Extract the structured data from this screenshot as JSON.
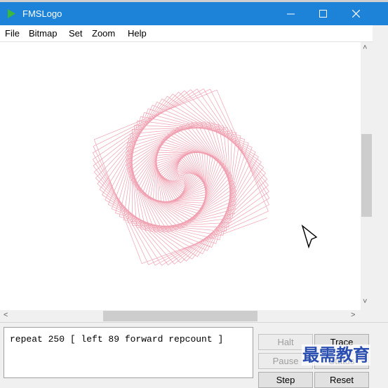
{
  "window": {
    "title": "FMSLogo",
    "icon": "play-triangle-icon",
    "accent": "#1c83d8"
  },
  "menu": {
    "items": [
      "File",
      "Bitmap",
      "Set",
      "Zoom",
      "Help"
    ]
  },
  "scroll": {
    "up": "˄",
    "down": "˅",
    "left": "<",
    "right": ">"
  },
  "command": {
    "text": "repeat 250 [ left 89 forward repcount ]"
  },
  "buttons": {
    "halt": "Halt",
    "trace": "Trace",
    "pause": "Pause",
    "status": "Status",
    "step": "Step",
    "reset": "Reset"
  },
  "drawing": {
    "stroke": "#f0a0b0",
    "repeat": 250,
    "turn": 89
  },
  "watermark": {
    "text": "最需教育"
  }
}
